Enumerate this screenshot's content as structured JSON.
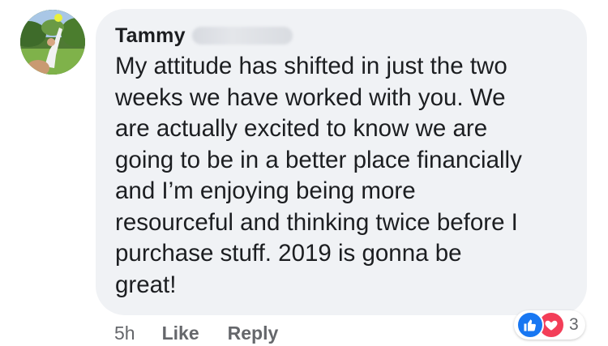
{
  "comment": {
    "author_name": "Tammy",
    "lines": [
      "My attitude has shifted in just the two",
      "weeks we have worked with you. We",
      "are actually excited to know we are",
      "going to be in a better place financially",
      "and I’m enjoying being more",
      "resourceful and thinking twice before I",
      "purchase stuff. 2019 is gonna be",
      "great!"
    ]
  },
  "actions": {
    "time": "5h",
    "like_label": "Like",
    "reply_label": "Reply"
  },
  "reactions": {
    "count": "3",
    "icons": [
      "like-icon",
      "love-icon"
    ],
    "like_color": "#1877f2",
    "love_color": "#f33e58"
  },
  "colors": {
    "bubble": "#f0f2f5",
    "text": "#1c1e21",
    "secondary": "#65676b"
  }
}
